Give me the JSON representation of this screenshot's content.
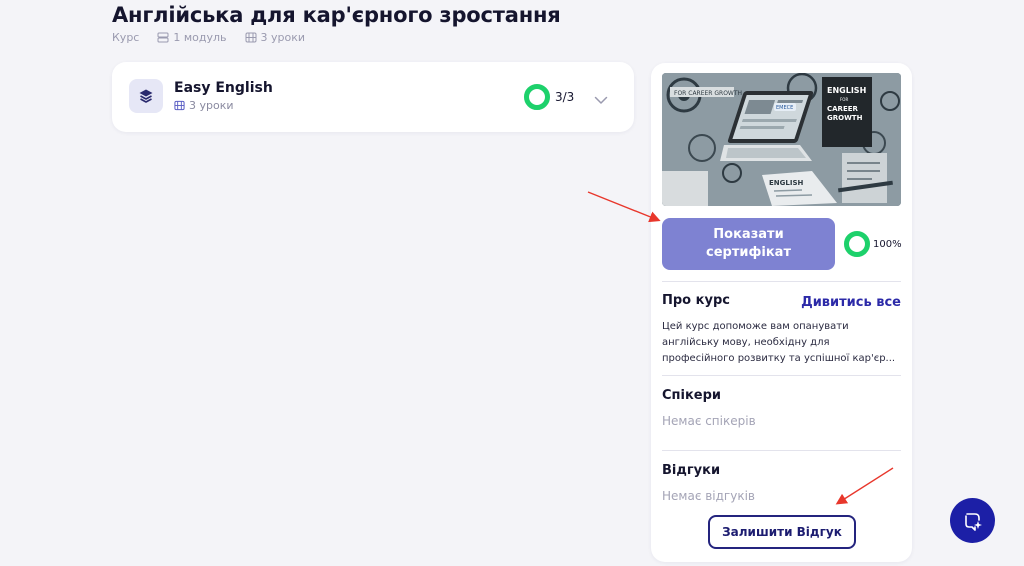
{
  "page": {
    "title": "Англійська для кар'єрного зростання",
    "meta": {
      "type": "Курс",
      "modules": "1 модуль",
      "lessons": "3 уроки"
    }
  },
  "module": {
    "title": "Easy English",
    "lessons": "3 уроки",
    "progress_text": "3/3",
    "progress_fraction": 1.0,
    "icon": "layers-icon"
  },
  "sidebar": {
    "cover": {
      "book_title": "ENGLISH",
      "book_for": "FOR",
      "book_subtitle_1": "CAREER",
      "book_subtitle_2": "GROWTH",
      "banner": "FOR CAREER GROWTH",
      "open_book": "ENGLISH",
      "sticker": "EMECE"
    },
    "certificate_button": "Показати сертифікат",
    "certificate_progress_text": "100%",
    "certificate_progress_fraction": 1.0,
    "about": {
      "title": "Про курс",
      "see_all": "Дивитись все",
      "lines": [
        "Цей курс допоможе вам опанувати",
        "англійську мову, необхідну для",
        "професійного розвитку та успішної кар'єр..."
      ]
    },
    "speakers": {
      "title": "Спікери",
      "empty": "Немає спікерів"
    },
    "reviews": {
      "title": "Відгуки",
      "empty": "Немає відгуків",
      "leave_review_button": "Залишити Відгук"
    }
  },
  "colors": {
    "accent": "#2c2aa8",
    "button_primary": "#7e82d2",
    "progress": "#1dd16b",
    "annotation_arrow": "#e8372c",
    "fab": "#1c1fa6"
  }
}
